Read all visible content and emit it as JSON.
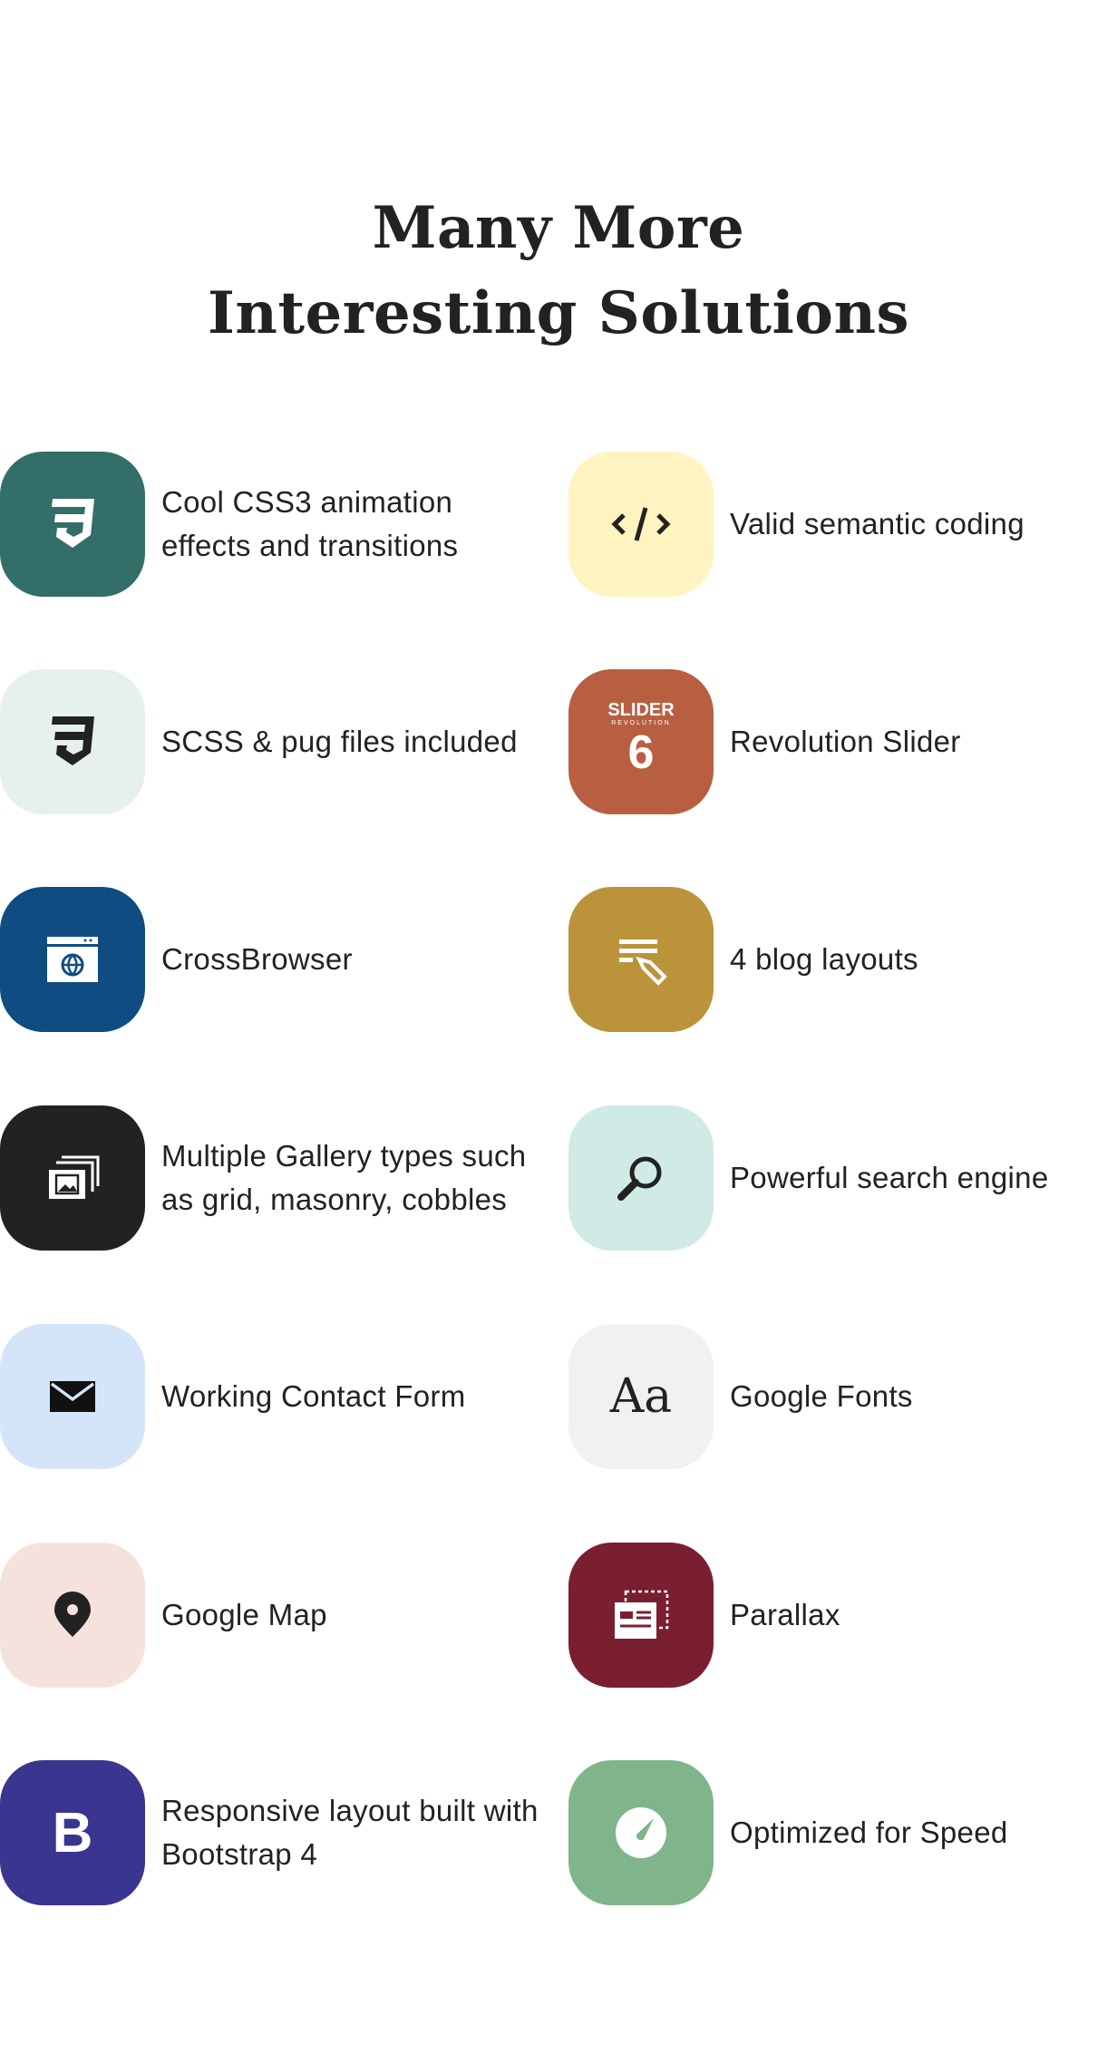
{
  "heading": {
    "line1": "Many More",
    "line2": "Interesting Solutions"
  },
  "features": [
    {
      "label": "Cool CSS3 animation effects and transitions",
      "icon": "css3-icon",
      "bg": "#336e68"
    },
    {
      "label": "Valid semantic coding",
      "icon": "code-icon",
      "bg": "#fff3c0"
    },
    {
      "label": "SCSS & pug files included",
      "icon": "css3-icon",
      "bg": "#e6f0ec"
    },
    {
      "label": "Revolution Slider",
      "icon": "slider-revolution-logo",
      "bg": "#b95f41",
      "logo_text": "SLIDER",
      "logo_sub": "REVOLUTION",
      "logo_num": "6"
    },
    {
      "label": "CrossBrowser",
      "icon": "browser-globe-icon",
      "bg": "#0f4c81"
    },
    {
      "label": "4 blog layouts",
      "icon": "blog-edit-icon",
      "bg": "#bb933a"
    },
    {
      "label": "Multiple Gallery types such as grid, masonry, cobbles",
      "icon": "gallery-icon",
      "bg": "#222222"
    },
    {
      "label": "Powerful search engine",
      "icon": "search-icon",
      "bg": "#d0ebe6"
    },
    {
      "label": "Working Contact Form",
      "icon": "envelope-icon",
      "bg": "#d4e5fa"
    },
    {
      "label": "Google Fonts",
      "icon": "font-icon",
      "bg": "#f1f1f3",
      "glyph": "Aa"
    },
    {
      "label": "Google Map",
      "icon": "map-pin-icon",
      "bg": "#f6e2dc"
    },
    {
      "label": "Parallax",
      "icon": "parallax-icon",
      "bg": "#7a1f2f"
    },
    {
      "label": "Responsive layout built with Bootstrap 4",
      "icon": "bootstrap-icon",
      "bg": "#3a358f",
      "glyph": "B"
    },
    {
      "label": "Optimized for Speed",
      "icon": "speedometer-icon",
      "bg": "#80b58c"
    }
  ]
}
